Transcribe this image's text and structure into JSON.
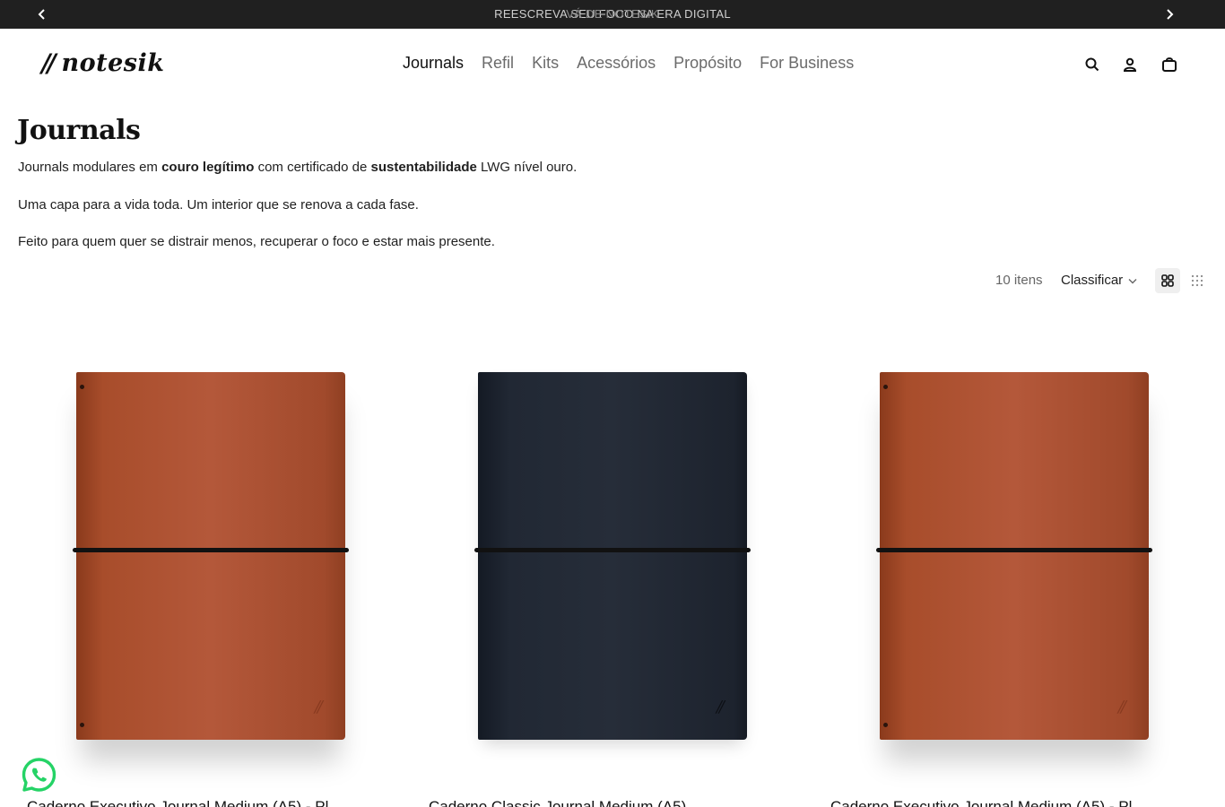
{
  "announcement": {
    "message_primary": "REESCREVA SEU FOCO NA ERA DIGITAL",
    "message_secondary": "VÁ DE NOTESIK",
    "prev_icon": "chevron-left-icon",
    "next_icon": "chevron-right-icon"
  },
  "header": {
    "logo_slashes": "//",
    "logo_text": "notesik",
    "nav": [
      "Journals",
      "Refil",
      "Kits",
      "Acessórios",
      "Propósito",
      "For Business"
    ],
    "icons": [
      "search-icon",
      "account-icon",
      "cart-icon"
    ]
  },
  "collection": {
    "title": "Journals",
    "intro": {
      "p1_a": "Journals modulares em ",
      "p1_b": "couro legítimo",
      "p1_c": " com certificado de ",
      "p1_d": "sustentabilidade",
      "p1_e": " LWG nível ouro.",
      "p2": "Uma capa para a vida toda. Um interior que se renova a cada fase.",
      "p3": "Feito para quem quer se distrair menos, recuperar o foco e estar mais presente."
    },
    "item_count": "10 itens",
    "sort_label": "Classificar",
    "views": [
      "grid-2-icon",
      "grid-4-icon"
    ]
  },
  "products": [
    {
      "name": "Caderno Executivo Journal Medium (A5) - Pl",
      "cover_color": "#b4583a"
    },
    {
      "name": "Caderno Classic Journal Medium (A5)",
      "cover_color": "#262d39"
    },
    {
      "name": "Caderno Executivo Journal Medium (A5) - Pl",
      "cover_color": "#b4583a"
    }
  ],
  "colors": {
    "announcement_bg": "#202020",
    "text": "#1a1a1a",
    "nav_muted": "#6b6b6b",
    "whatsapp": "#25d366"
  },
  "floating": {
    "whatsapp_icon": "whatsapp-icon"
  }
}
